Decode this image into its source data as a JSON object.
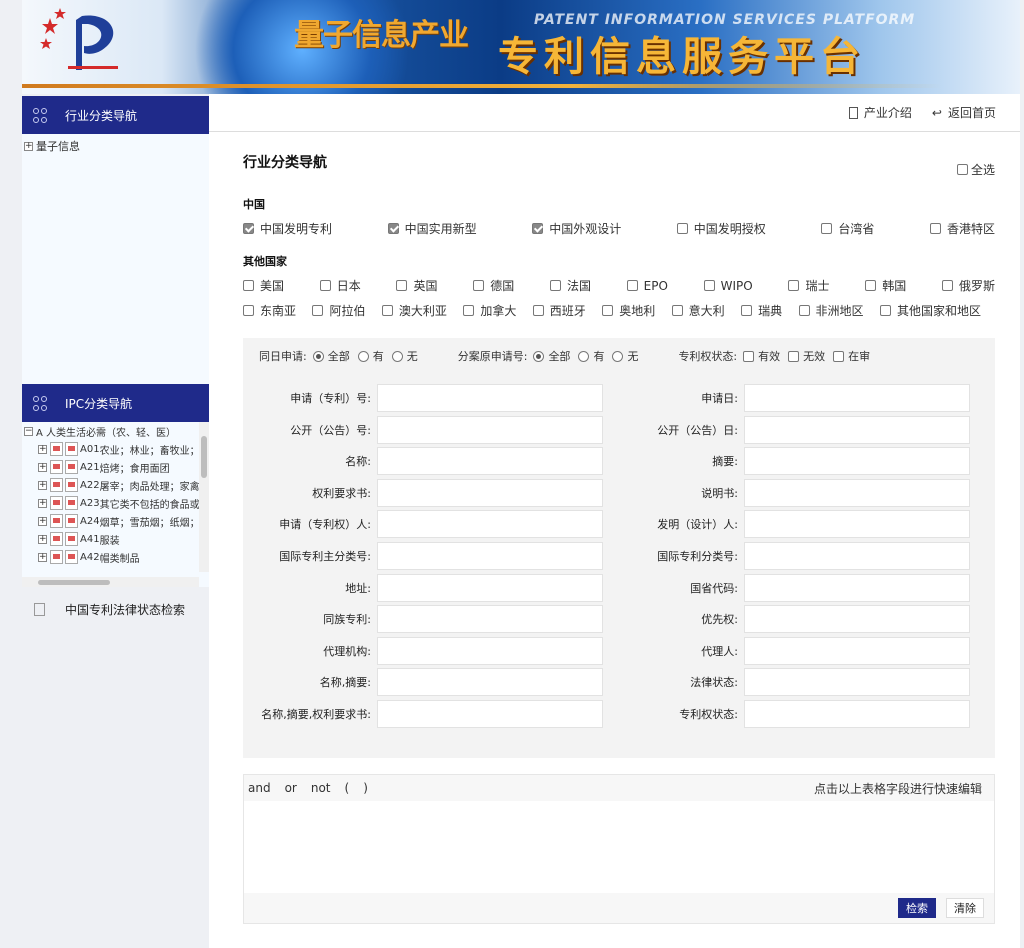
{
  "banner": {
    "title_cn": "量子信息产业",
    "title_en": "PATENT INFORMATION SERVICES PLATFORM",
    "title_main": "专利信息服务平台"
  },
  "sidebar": {
    "industry_title": "行业分类导航",
    "industry_tree": [
      {
        "label": "量子信息",
        "expander": "+"
      }
    ],
    "ipc_title": "IPC分类导航",
    "ipc_root": {
      "label": "A 人类生活必需（农、轻、医）",
      "expander": "−"
    },
    "ipc_nodes": [
      {
        "code": "A01",
        "label": "农业；林业；畜牧业；"
      },
      {
        "code": "A21",
        "label": "焙烤；食用面团"
      },
      {
        "code": "A22",
        "label": "屠宰；肉品处理；家禽"
      },
      {
        "code": "A23",
        "label": "其它类不包括的食品或"
      },
      {
        "code": "A24",
        "label": "烟草；雪茄烟；纸烟；"
      },
      {
        "code": "A41",
        "label": "服装"
      },
      {
        "code": "A42",
        "label": "帽类制品"
      }
    ],
    "legal_label": "中国专利法律状态检索"
  },
  "topbar": {
    "intro": "产业介绍",
    "home": "返回首页"
  },
  "pane": {
    "title": "行业分类导航",
    "select_all": "全选",
    "china_title": "中国",
    "china": [
      {
        "label": "中国发明专利",
        "checked": true
      },
      {
        "label": "中国实用新型",
        "checked": true
      },
      {
        "label": "中国外观设计",
        "checked": true
      },
      {
        "label": "中国发明授权",
        "checked": false
      },
      {
        "label": "台湾省",
        "checked": false
      },
      {
        "label": "香港特区",
        "checked": false
      }
    ],
    "other_title": "其他国家",
    "other_row1": [
      "美国",
      "日本",
      "英国",
      "德国",
      "法国",
      "EPO",
      "WIPO",
      "瑞士",
      "韩国",
      "俄罗斯"
    ],
    "other_row2": [
      "东南亚",
      "阿拉伯",
      "澳大利亚",
      "加拿大",
      "西班牙",
      "奥地利",
      "意大利",
      "瑞典",
      "非洲地区",
      "其他国家和地区"
    ]
  },
  "filters": {
    "same_day": {
      "label": "同日申请:",
      "options": [
        "全部",
        "有",
        "无"
      ],
      "selected": 0
    },
    "divisional": {
      "label": "分案原申请号:",
      "options": [
        "全部",
        "有",
        "无"
      ],
      "selected": 0
    },
    "status": {
      "label": "专利权状态:",
      "options": [
        "有效",
        "无效",
        "在审"
      ]
    }
  },
  "fields_left": [
    "申请（专利）号:",
    "公开（公告）号:",
    "名称:",
    "权利要求书:",
    "申请（专利权）人:",
    "国际专利主分类号:",
    "地址:",
    "同族专利:",
    "代理机构:",
    "名称,摘要:",
    "名称,摘要,权利要求书:"
  ],
  "fields_right": [
    "申请日:",
    "公开（公告）日:",
    "摘要:",
    "说明书:",
    "发明（设计）人:",
    "国际专利分类号:",
    "国省代码:",
    "优先权:",
    "代理人:",
    "法律状态:",
    "专利权状态:"
  ],
  "logic": {
    "operators": [
      "and",
      "or",
      "not",
      "(",
      ")"
    ],
    "hint": "点击以上表格字段进行快速编辑",
    "search": "检索",
    "clear": "清除"
  }
}
